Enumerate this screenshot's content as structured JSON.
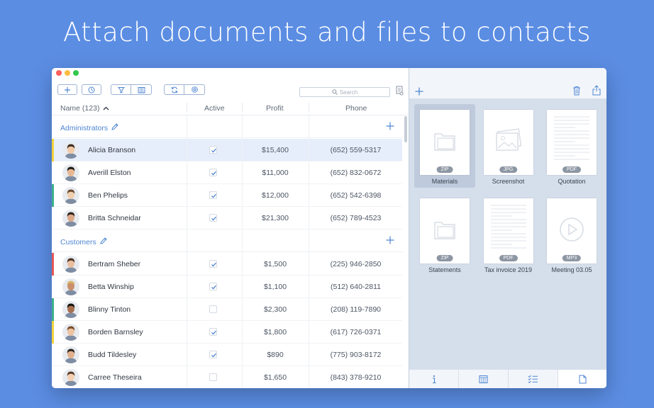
{
  "headline": "Attach documents and files to contacts",
  "colors": {
    "background": "#5b8de3",
    "accent": "#4f86d3"
  },
  "toolbar": {
    "buttons": [
      "plus-icon",
      "clock-icon",
      "filter-icon",
      "calendar-icon",
      "refresh-icon",
      "gear-icon"
    ],
    "search_placeholder": "Search"
  },
  "columns": {
    "name": "Name (123)",
    "active": "Active",
    "profit": "Profit",
    "phone": "Phone"
  },
  "groups": [
    {
      "title": "Administrators",
      "rows": [
        {
          "name": "Alicia Branson",
          "active": true,
          "profit": "$15,400",
          "phone": "(652) 559-5317",
          "tag": "#f2d23c",
          "selected": true
        },
        {
          "name": "Averill Elston",
          "active": true,
          "profit": "$11,000",
          "phone": "(652) 832-0672",
          "tag": "",
          "selected": false
        },
        {
          "name": "Ben Phelips",
          "active": true,
          "profit": "$12,000",
          "phone": "(652) 542-6398",
          "tag": "#3db08a",
          "selected": false
        },
        {
          "name": "Britta Schneidar",
          "active": true,
          "profit": "$21,300",
          "phone": "(652) 789-4523",
          "tag": "",
          "selected": false
        }
      ]
    },
    {
      "title": "Customers",
      "rows": [
        {
          "name": "Bertram Sheber",
          "active": true,
          "profit": "$1,500",
          "phone": "(225) 946-2850",
          "tag": "#e45757",
          "selected": false
        },
        {
          "name": "Betta Winship",
          "active": true,
          "profit": "$1,100",
          "phone": "(512) 640-2811",
          "tag": "",
          "selected": false
        },
        {
          "name": "Blinny Tinton",
          "active": false,
          "profit": "$2,300",
          "phone": "(208) 119-7890",
          "tag": "#3db08a",
          "selected": false
        },
        {
          "name": "Borden Barnsley",
          "active": true,
          "profit": "$1,800",
          "phone": "(617) 726-0371",
          "tag": "#f2d23c",
          "selected": false
        },
        {
          "name": "Budd Tildesley",
          "active": true,
          "profit": "$890",
          "phone": "(775) 903-8172",
          "tag": "",
          "selected": false
        },
        {
          "name": "Carree Theseira",
          "active": false,
          "profit": "$1,650",
          "phone": "(843) 378-9210",
          "tag": "",
          "selected": false
        }
      ]
    }
  ],
  "files": [
    {
      "name": "Materials",
      "type": "ZIP",
      "icon": "folder-icon",
      "selected": true
    },
    {
      "name": "Screenshot",
      "type": "JPG",
      "icon": "image-icon",
      "selected": false
    },
    {
      "name": "Quotation",
      "type": "PDF",
      "icon": "text-lines-icon",
      "selected": false
    },
    {
      "name": "Statements",
      "type": "ZIP",
      "icon": "folder-icon",
      "selected": false
    },
    {
      "name": "Tax invoice 2019",
      "type": "PDF",
      "icon": "text-lines-icon",
      "selected": false
    },
    {
      "name": "Meeting 03.05",
      "type": "MP3",
      "icon": "play-icon",
      "selected": false
    }
  ],
  "bottom_tabs": [
    "info-icon",
    "calendar-icon",
    "checklist-icon",
    "document-icon"
  ]
}
